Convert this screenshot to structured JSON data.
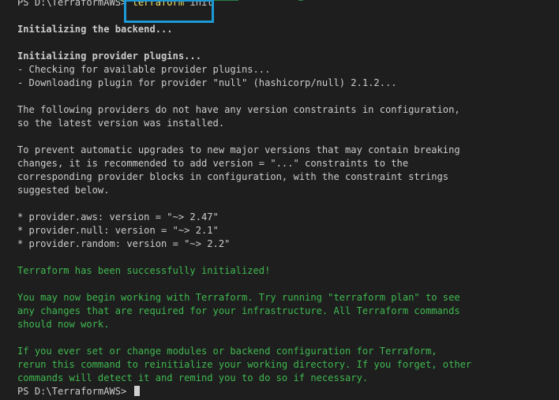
{
  "prompt": "PS D:\\TerraformAWS>",
  "command": {
    "name": "terraform",
    "arg": "init"
  },
  "output": {
    "backend": "Initializing the backend...",
    "plugins_header": "Initializing provider plugins...",
    "plugin_lines": [
      "- Checking for available provider plugins...",
      "- Downloading plugin for provider \"null\" (hashicorp/null) 2.1.2..."
    ],
    "constraints_note": [
      "The following providers do not have any version constraints in configuration,",
      "so the latest version was installed."
    ],
    "upgrade_note": [
      "To prevent automatic upgrades to new major versions that may contain breaking",
      "changes, it is recommended to add version = \"...\" constraints to the",
      "corresponding provider blocks in configuration, with the constraint strings",
      "suggested below."
    ],
    "providers": [
      "* provider.aws: version = \"~> 2.47\"",
      "* provider.null: version = \"~> 2.1\"",
      "* provider.random: version = \"~> 2.2\""
    ],
    "success": "Terraform has been successfully initialized!",
    "next_steps": [
      "You may now begin working with Terraform. Try running \"terraform plan\" to see",
      "any changes that are required for your infrastructure. All Terraform commands",
      "should now work."
    ],
    "reinit_note": [
      "If you ever set or change modules or backend configuration for Terraform,",
      "rerun this command to reinitialize your working directory. If you forget, other",
      "commands will detect it and remind you to do so if necessary."
    ]
  },
  "colors": {
    "background": "#1e1e1e",
    "text": "#cccccc",
    "success_green": "#3fb950",
    "command_yellow": "#f0e36a",
    "highlight_blue": "#1c9ad6"
  }
}
